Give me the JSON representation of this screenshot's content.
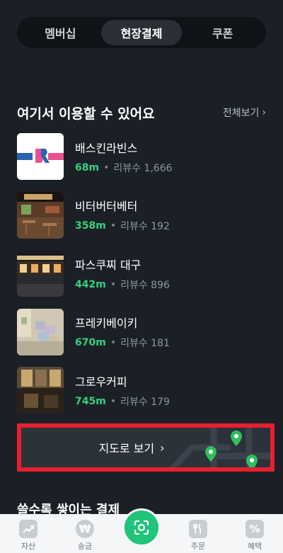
{
  "tabs": [
    {
      "label": "멤버십",
      "active": false
    },
    {
      "label": "현장결제",
      "active": true
    },
    {
      "label": "쿠폰",
      "active": false
    }
  ],
  "section": {
    "title": "여기서 이용할 수 있어요",
    "see_all": "전체보기"
  },
  "stores": [
    {
      "name": "배스킨라빈스",
      "distance": "68m",
      "reviews": "리뷰수 1,666",
      "thumb": "baskin-robbins-logo"
    },
    {
      "name": "비터버터베터",
      "distance": "358m",
      "reviews": "리뷰수 192",
      "thumb": "cafe-terrace-photo"
    },
    {
      "name": "파스쿠찌 대구",
      "distance": "442m",
      "reviews": "리뷰수 896",
      "thumb": "storefront-night-photo"
    },
    {
      "name": "프레키베이키",
      "distance": "670m",
      "reviews": "리뷰수 181",
      "thumb": "bakery-interior-photo"
    },
    {
      "name": "그로우커피",
      "distance": "745m",
      "reviews": "리뷰수 179",
      "thumb": "coffee-shop-photo"
    }
  ],
  "map_button": {
    "label": "지도로 보기"
  },
  "next_section": {
    "title": "쓸수록 쌓이는 결제"
  },
  "bottom_nav": [
    {
      "label": "자산",
      "icon": "chart-up-icon"
    },
    {
      "label": "송금",
      "icon": "won-icon"
    },
    {
      "label": "",
      "icon": "scan-icon"
    },
    {
      "label": "주문",
      "icon": "fork-knife-icon"
    },
    {
      "label": "혜택",
      "icon": "percent-icon"
    }
  ],
  "colors": {
    "background": "#1b2027",
    "accent_green": "#35d07f",
    "highlight_red": "#e8202e"
  }
}
